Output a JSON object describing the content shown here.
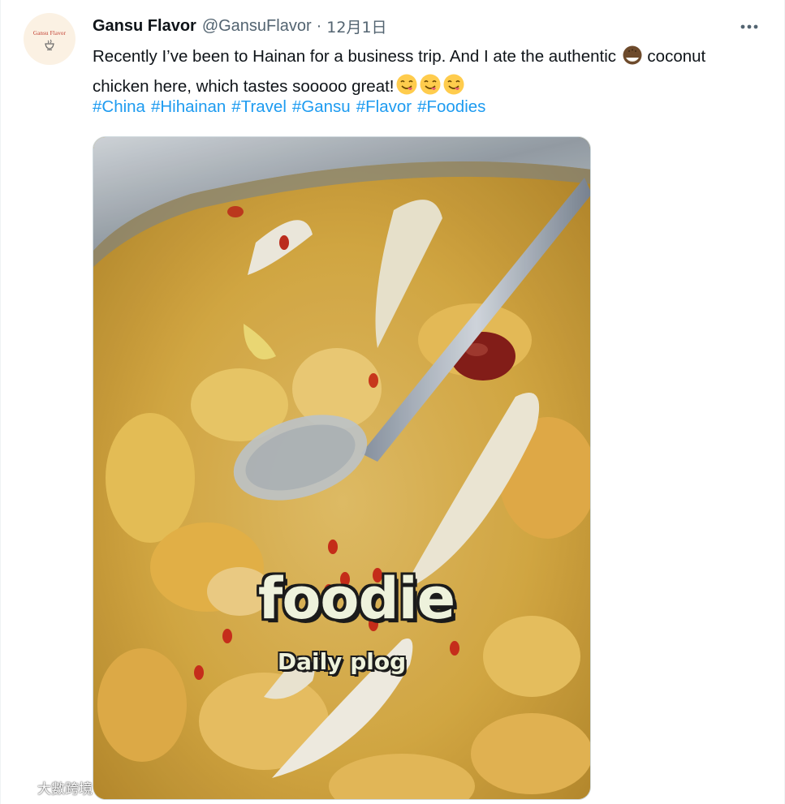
{
  "tweet": {
    "avatar_text": "Gansu Flavor",
    "display_name": "Gansu Flavor",
    "handle": "@GansuFlavor",
    "separator": "·",
    "timestamp": "12月1日",
    "text_part1": "Recently I’ve been to Hainan for a business trip. And I ate the authentic ",
    "text_part2": " coconut chicken here, which tastes sooooo great!",
    "emojis": [
      "coconut-emoji",
      "yum-face-emoji",
      "yum-face-emoji",
      "yum-face-emoji"
    ],
    "hashtags": [
      "#China",
      "#Hihainan",
      "#Travel",
      "#Gansu",
      "#Flavor",
      "#Foodies"
    ],
    "media": {
      "overlay_title": "foodie",
      "overlay_subtitle": "Daily plog"
    }
  },
  "watermark": {
    "text": "大數跨境"
  },
  "colors": {
    "link": "#1d9bf0",
    "secondary_text": "#536471",
    "primary_text": "#0f1419",
    "border": "#cfd9de"
  }
}
